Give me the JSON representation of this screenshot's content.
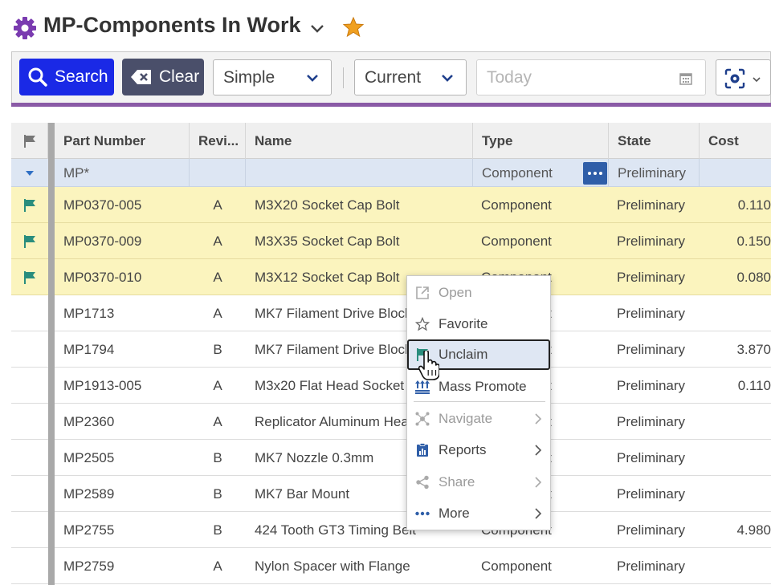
{
  "title": {
    "text": "MP-Components In Work",
    "icon": "gear-icon"
  },
  "toolbar": {
    "search_label": "Search",
    "clear_label": "Clear",
    "mode_select": "Simple",
    "revision_select": "Current",
    "date_placeholder": "Today"
  },
  "grid": {
    "columns": [
      "Part Number",
      "Revi...",
      "Name",
      "Type",
      "State",
      "Cost"
    ],
    "filter": {
      "part_number": "MP*",
      "type": "Component",
      "state": "Preliminary"
    },
    "rows": [
      {
        "claimed": true,
        "part_number": "MP0370-005",
        "rev": "A",
        "name": "M3X20 Socket Cap Bolt",
        "type": "Component",
        "state": "Preliminary",
        "cost": "0.110"
      },
      {
        "claimed": true,
        "part_number": "MP0370-009",
        "rev": "A",
        "name": "M3X35 Socket Cap Bolt",
        "type": "Component",
        "state": "Preliminary",
        "cost": "0.150"
      },
      {
        "claimed": true,
        "part_number": "MP0370-010",
        "rev": "A",
        "name": "M3X12 Socket Cap Bolt",
        "type": "Component",
        "state": "Preliminary",
        "cost": "0.080"
      },
      {
        "claimed": false,
        "part_number": "MP1713",
        "rev": "A",
        "name": "MK7 Filament Drive Block",
        "type": "Component",
        "state": "Preliminary",
        "cost": ""
      },
      {
        "claimed": false,
        "part_number": "MP1794",
        "rev": "B",
        "name": "MK7 Filament Drive Block",
        "type": "Component",
        "state": "Preliminary",
        "cost": "3.870"
      },
      {
        "claimed": false,
        "part_number": "MP1913-005",
        "rev": "A",
        "name": "M3x20 Flat Head Socket",
        "type": "Component",
        "state": "Preliminary",
        "cost": "0.110"
      },
      {
        "claimed": false,
        "part_number": "MP2360",
        "rev": "A",
        "name": "Replicator Aluminum Hea",
        "type": "Component",
        "state": "Preliminary",
        "cost": ""
      },
      {
        "claimed": false,
        "part_number": "MP2505",
        "rev": "B",
        "name": "MK7 Nozzle 0.3mm",
        "type": "Component",
        "state": "Preliminary",
        "cost": ""
      },
      {
        "claimed": false,
        "part_number": "MP2589",
        "rev": "B",
        "name": "MK7 Bar Mount",
        "type": "Component",
        "state": "Preliminary",
        "cost": ""
      },
      {
        "claimed": false,
        "part_number": "MP2755",
        "rev": "B",
        "name": "424 Tooth GT3 Timing Belt",
        "type": "Component",
        "state": "Preliminary",
        "cost": "4.980"
      },
      {
        "claimed": false,
        "part_number": "MP2759",
        "rev": "A",
        "name": "Nylon Spacer with Flange",
        "type": "Component",
        "state": "Preliminary",
        "cost": ""
      }
    ]
  },
  "context_menu": {
    "items": [
      {
        "label": "Open",
        "icon": "open-external-icon",
        "disabled": true,
        "submenu": false
      },
      {
        "label": "Favorite",
        "icon": "star-outline-icon",
        "disabled": false,
        "submenu": false
      },
      {
        "label": "Unclaim",
        "icon": "flag-icon",
        "disabled": false,
        "submenu": false,
        "active": true
      },
      {
        "label": "Mass Promote",
        "icon": "mass-promote-icon",
        "disabled": false,
        "submenu": false
      },
      {
        "label": "Navigate",
        "icon": "navigate-icon",
        "disabled": true,
        "submenu": true
      },
      {
        "label": "Reports",
        "icon": "report-icon",
        "disabled": false,
        "submenu": true
      },
      {
        "label": "Share",
        "icon": "share-icon",
        "disabled": true,
        "submenu": true
      },
      {
        "label": "More",
        "icon": "more-dots-icon",
        "disabled": false,
        "submenu": true
      }
    ]
  },
  "colors": {
    "accent": "#8a5aa6",
    "search_button": "#1a29e6",
    "clear_button": "#4a4f6a",
    "claimed_row": "#fbf4be",
    "flag": "#2a8d7d",
    "star": "#f0a020"
  }
}
